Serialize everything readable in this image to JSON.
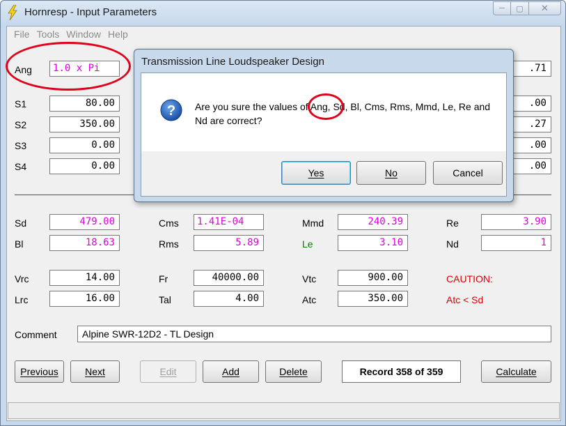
{
  "window": {
    "title": "Hornresp - Input Parameters"
  },
  "menu": [
    "File",
    "Tools",
    "Window",
    "Help"
  ],
  "top_fields": {
    "ang": {
      "label": "Ang",
      "value": "1.0 x Pi"
    },
    "s1": {
      "label": "S1",
      "value": "80.00"
    },
    "s2": {
      "label": "S2",
      "value": "350.00"
    },
    "s3": {
      "label": "S3",
      "value": "0.00"
    },
    "s4": {
      "label": "S4",
      "value": "0.00"
    },
    "right_partial": [
      ".71",
      ".00",
      ".27",
      ".00",
      ".00"
    ]
  },
  "driver_fields": {
    "sd": {
      "label": "Sd",
      "value": "479.00"
    },
    "bl": {
      "label": "Bl",
      "value": "18.63"
    },
    "cms": {
      "label": "Cms",
      "value": "1.41E-04"
    },
    "rms": {
      "label": "Rms",
      "value": "5.89"
    },
    "mmd": {
      "label": "Mmd",
      "value": "240.39"
    },
    "le": {
      "label": "Le",
      "value": "3.10"
    },
    "re": {
      "label": "Re",
      "value": "3.90"
    },
    "nd": {
      "label": "Nd",
      "value": "1"
    }
  },
  "chamber_fields": {
    "vrc": {
      "label": "Vrc",
      "value": "14.00"
    },
    "lrc": {
      "label": "Lrc",
      "value": "16.00"
    },
    "fr": {
      "label": "Fr",
      "value": "40000.00"
    },
    "tal": {
      "label": "Tal",
      "value": "4.00"
    },
    "vtc": {
      "label": "Vtc",
      "value": "900.00"
    },
    "atc": {
      "label": "Atc",
      "value": "350.00"
    },
    "caution_title": "CAUTION:",
    "caution_text": "Atc < Sd"
  },
  "comment": {
    "label": "Comment",
    "value": "Alpine SWR-12D2 - TL Design"
  },
  "buttons": {
    "previous": "Previous",
    "next": "Next",
    "edit": "Edit",
    "add": "Add",
    "delete": "Delete",
    "record": "Record 358 of 359",
    "calculate": "Calculate"
  },
  "dialog": {
    "title": "Transmission Line Loudspeaker Design",
    "message": "Are you sure the values of Ang, Sd, Bl, Cms, Rms, Mmd, Le, Re and Nd are correct?",
    "yes": "Yes",
    "no": "No",
    "cancel": "Cancel"
  },
  "colors": {
    "value_magenta": "#e000e0",
    "label_green": "#008000",
    "caution_red": "#e00000",
    "annotation_red": "#e0001a"
  }
}
